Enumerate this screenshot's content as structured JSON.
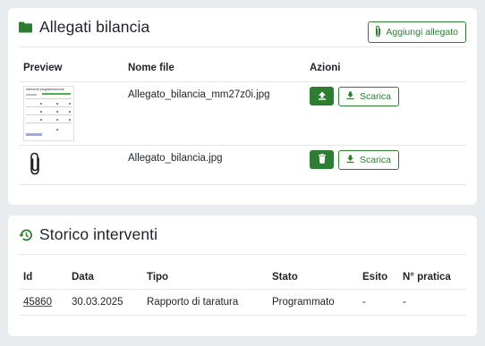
{
  "attachments": {
    "title": "Allegati bilancia",
    "add_button_label": "Aggiungi allegato",
    "columns": {
      "preview": "Preview",
      "filename": "Nome file",
      "actions": "Azioni"
    },
    "rows": [
      {
        "filename": "Allegato_bilancia_mm27z0i.jpg",
        "preview": "thumbnail",
        "action_icon": "upload-icon",
        "download_label": "Scarica"
      },
      {
        "filename": "Allegato_bilancia.jpg",
        "preview": "paperclip-icon",
        "action_icon": "trash-icon",
        "download_label": "Scarica"
      }
    ],
    "thumbnail_title": "Interventi programmazione"
  },
  "history": {
    "title": "Storico interventi",
    "columns": {
      "id": "Id",
      "date": "Data",
      "type": "Tipo",
      "status": "Stato",
      "outcome": "Esito",
      "practice": "N° pratica"
    },
    "rows": [
      {
        "id": "45860",
        "date": "30.03.2025",
        "type": "Rapporto di taratura",
        "status": "Programmato",
        "outcome": "-",
        "practice": "-"
      }
    ]
  },
  "colors": {
    "accent": "#2e7d32",
    "background": "#e9ecef",
    "card": "#ffffff"
  }
}
